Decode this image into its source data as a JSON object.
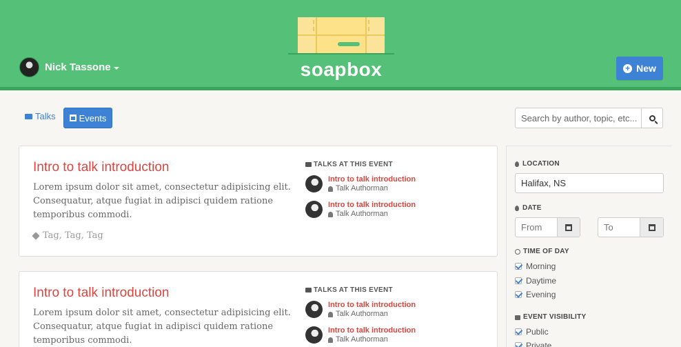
{
  "header": {
    "user_name": "Nick Tassone",
    "logo_text": "soapbox",
    "new_button_label": "New",
    "background_color": "#55c078"
  },
  "tabs": [
    {
      "label": "Talks",
      "active": false
    },
    {
      "label": "Events",
      "active": true
    }
  ],
  "search": {
    "placeholder": "Search by author, topic, etc..."
  },
  "events": [
    {
      "title": "Intro to talk introduction",
      "description": "Lorem ipsum dolor sit amet, consectetur adipisicing elit. Consequatur, atque fugiat in adipisci quidem ratione temporibus commodi.",
      "tags": "Tag, Tag, Tag",
      "talks_heading": "TALKS AT THIS EVENT",
      "talks": [
        {
          "title": "Intro to talk introduction",
          "author": "Talk Authorman"
        },
        {
          "title": "Intro to talk introduction",
          "author": "Talk Authorman"
        }
      ]
    },
    {
      "title": "Intro to talk introduction",
      "description": "Lorem ipsum dolor sit amet, consectetur adipisicing elit. Consequatur, atque fugiat in adipisci quidem ratione temporibus commodi.",
      "talks_heading": "TALKS AT THIS EVENT",
      "talks": [
        {
          "title": "Intro to talk introduction",
          "author": "Talk Authorman"
        },
        {
          "title": "Intro to talk introduction",
          "author": "Talk Authorman"
        }
      ]
    }
  ],
  "filters": {
    "location_label": "LOCATION",
    "location_value": "Halifax, NS",
    "date_label": "DATE",
    "date_from_placeholder": "From",
    "date_to_placeholder": "To",
    "time_label": "TIME OF DAY",
    "time_options": [
      {
        "label": "Morning",
        "checked": true
      },
      {
        "label": "Daytime",
        "checked": true
      },
      {
        "label": "Evening",
        "checked": true
      }
    ],
    "visibility_label": "EVENT VISIBILITY",
    "visibility_options": [
      {
        "label": "Public",
        "checked": true
      },
      {
        "label": "Private",
        "checked": true
      }
    ]
  },
  "colors": {
    "accent_blue": "#3d82d4",
    "title_red": "#d9463f"
  }
}
